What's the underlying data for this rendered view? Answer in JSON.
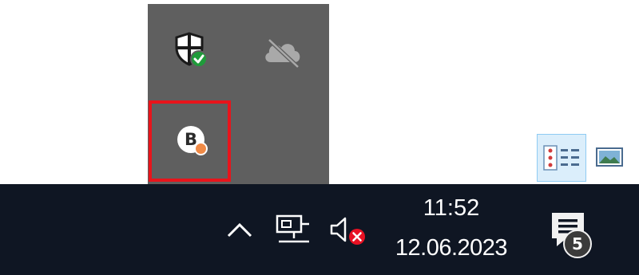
{
  "flyout": {
    "icons": [
      {
        "name": "windows-security-icon",
        "tooltip": ""
      },
      {
        "name": "onedrive-offline-icon",
        "tooltip": ""
      },
      {
        "name": "b-app-icon",
        "letter": "B",
        "status_color": "#f08a46"
      }
    ],
    "highlight_color": "#e8141b"
  },
  "view_buttons": [
    {
      "name": "details-view-icon",
      "active": true
    },
    {
      "name": "large-icons-view-icon",
      "active": false
    }
  ],
  "taskbar": {
    "show_hidden_icons": "chevron-up-icon",
    "network": "network-icon",
    "volume": "volume-muted-icon",
    "clock": {
      "time": "11:52",
      "date": "12.06.2023"
    },
    "notifications": {
      "icon": "action-center-icon",
      "count": "5"
    }
  },
  "colors": {
    "taskbar_bg": "#0f1623",
    "flyout_bg": "#5f5f5f",
    "defender_check": "#1f9b3a",
    "muted_x": "#e81123"
  }
}
